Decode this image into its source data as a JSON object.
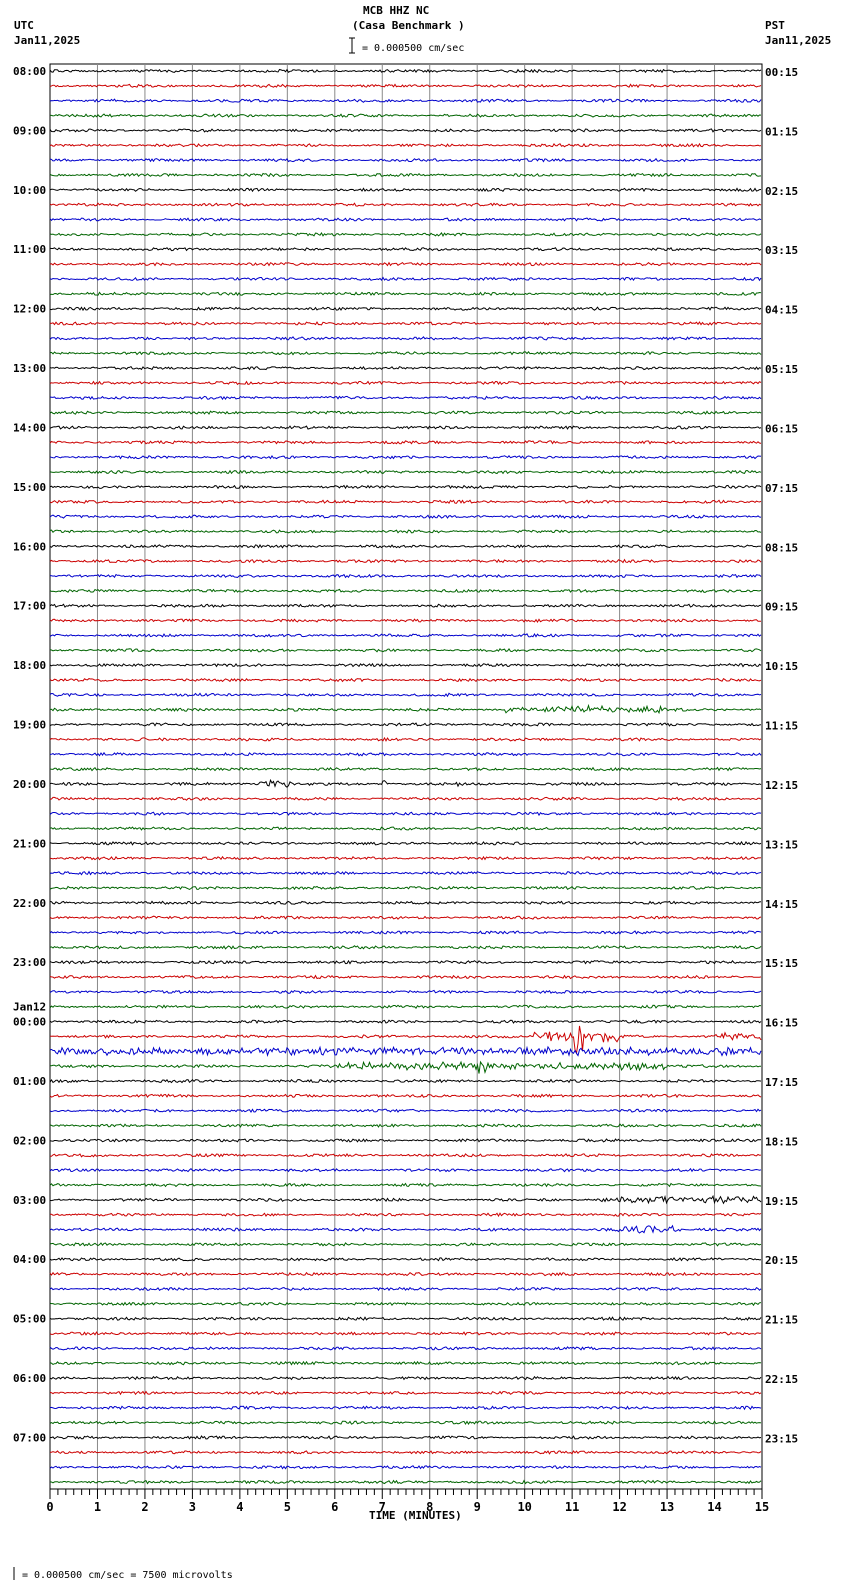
{
  "header": {
    "title": "MCB HHZ NC",
    "subtitle": "(Casa Benchmark )",
    "left_tz": "UTC",
    "left_date": "Jan11,2025",
    "right_tz": "PST",
    "right_date": "Jan11,2025",
    "scale": "= 0.000500 cm/sec"
  },
  "footer": {
    "scale": "= 0.000500 cm/sec =    7500 microvolts"
  },
  "chart_data": {
    "type": "line",
    "title": "MCB HHZ NC (Casa Benchmark )",
    "xlabel": "TIME (MINUTES)",
    "xlim": [
      0,
      15
    ],
    "xticks": [
      "0",
      "1",
      "2",
      "3",
      "4",
      "5",
      "6",
      "7",
      "8",
      "9",
      "10",
      "11",
      "12",
      "13",
      "14",
      "15"
    ],
    "rows_per_hour": 4,
    "trace_colors": [
      "#000000",
      "#cc0000",
      "#0000cc",
      "#006400"
    ],
    "left_labels": [
      "08:00",
      "09:00",
      "10:00",
      "11:00",
      "12:00",
      "13:00",
      "14:00",
      "15:00",
      "16:00",
      "17:00",
      "18:00",
      "19:00",
      "20:00",
      "21:00",
      "22:00",
      "23:00",
      "00:00",
      "01:00",
      "02:00",
      "03:00",
      "04:00",
      "05:00",
      "06:00",
      "07:00"
    ],
    "date_change_label": "Jan12",
    "right_labels": [
      "00:15",
      "01:15",
      "02:15",
      "03:15",
      "04:15",
      "05:15",
      "06:15",
      "07:15",
      "08:15",
      "09:15",
      "10:15",
      "11:15",
      "12:15",
      "13:15",
      "14:15",
      "15:15",
      "16:15",
      "17:15",
      "18:15",
      "19:15",
      "20:15",
      "21:15",
      "22:15",
      "23:15"
    ],
    "events": [
      {
        "row": 43,
        "start_min": 9.6,
        "end_min": 13,
        "amp": 3
      },
      {
        "row": 48,
        "start_min": 4.4,
        "end_min": 5.1,
        "amp": 3
      },
      {
        "row": 48,
        "start_min": 7,
        "end_min": 7.1,
        "amp": 4
      },
      {
        "row": 48,
        "start_min": 8.4,
        "end_min": 8.6,
        "amp": 2
      },
      {
        "row": 65,
        "start_min": 10.2,
        "end_min": 12,
        "amp": 4
      },
      {
        "row": 65,
        "start_min": 11,
        "end_min": 11.3,
        "amp": 12
      },
      {
        "row": 65,
        "start_min": 14,
        "end_min": 15,
        "amp": 3
      },
      {
        "row": 66,
        "start_min": 0,
        "end_min": 15,
        "amp": 3
      },
      {
        "row": 67,
        "start_min": 9,
        "end_min": 9.4,
        "amp": 8
      },
      {
        "row": 67,
        "start_min": 6,
        "end_min": 13,
        "amp": 3
      },
      {
        "row": 76,
        "start_min": 11.5,
        "end_min": 15,
        "amp": 2.5
      },
      {
        "row": 78,
        "start_min": 11.8,
        "end_min": 13.3,
        "amp": 3
      }
    ]
  }
}
